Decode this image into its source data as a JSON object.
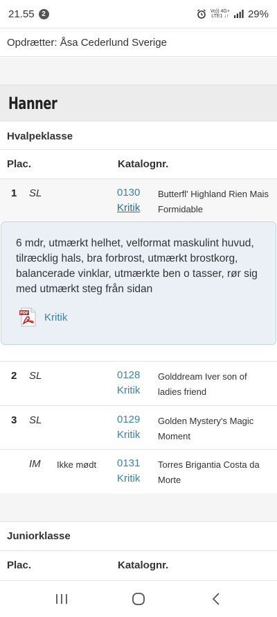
{
  "status_bar": {
    "time": "21.55",
    "notification_count": "2",
    "network_top": "Vo)) 4G+",
    "network_bottom": "LTE1 ↓↑",
    "battery": "29%"
  },
  "breeder": "Opdrætter: Åsa Cederlund Sverige",
  "section": {
    "title": "Hanner"
  },
  "classes": [
    {
      "title": "Hvalpeklasse",
      "col_place": "Plac.",
      "col_catalog": "Katalognr.",
      "entries": [
        {
          "place": "1",
          "grade": "SL",
          "attendance": "",
          "catalog": "0130",
          "kritik": "Kritik",
          "name": "Butterfl' Highland Rien Mais Formidable"
        },
        {
          "place": "2",
          "grade": "SL",
          "attendance": "",
          "catalog": "0128",
          "kritik": "Kritik",
          "name": "Golddream Iver son of ladies friend"
        },
        {
          "place": "3",
          "grade": "SL",
          "attendance": "",
          "catalog": "0129",
          "kritik": "Kritik",
          "name": "Golden Mystery's Magic Moment"
        },
        {
          "place": "",
          "grade": "IM",
          "attendance": "Ikke mødt",
          "catalog": "0131",
          "kritik": "Kritik",
          "name": "Torres Brigantia Costa da Morte"
        }
      ],
      "critique": {
        "text": "6 mdr, utmærkt helhet, velformat maskulint huvud, tilræcklig hals, bra forbrost, utmærkt brostkorg, balancerade vinklar, utmærkte ben o tasser, rør sig med utmærkt steg från sidan",
        "pdf_label": "Kritik"
      }
    },
    {
      "title": "Juniorklasse",
      "col_place": "Plac.",
      "col_catalog": "Katalognr."
    }
  ],
  "colors": {
    "link": "#3b82a8",
    "section_bg": "#ececec",
    "critique_bg": "#eaf0f6"
  }
}
